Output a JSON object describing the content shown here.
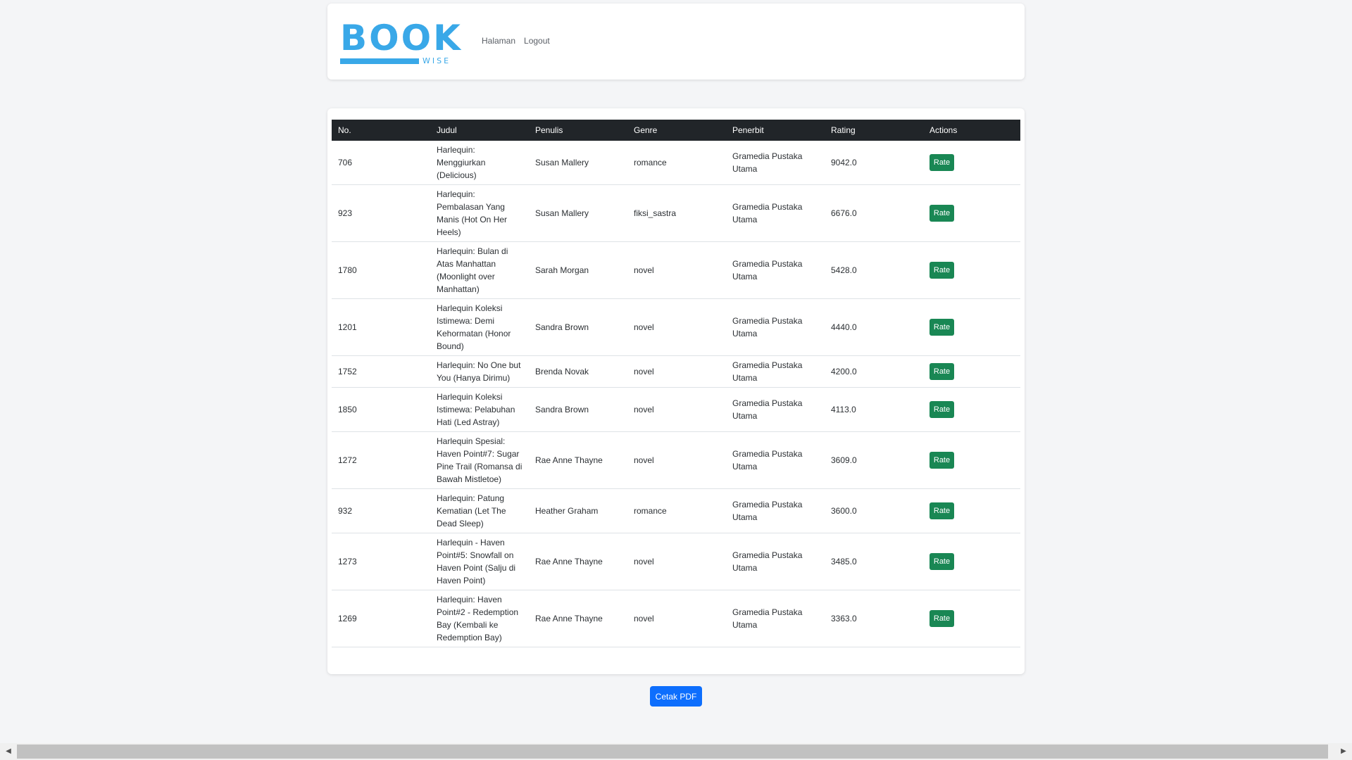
{
  "header": {
    "logo_word": "BOOK",
    "logo_sub": "WISE",
    "brand_color": "#39a8e8",
    "nav": [
      {
        "label": "Halaman"
      },
      {
        "label": "Logout"
      }
    ]
  },
  "table": {
    "columns": [
      "No.",
      "Judul",
      "Penulis",
      "Genre",
      "Penerbit",
      "Rating",
      "Actions"
    ],
    "action_label": "Rate",
    "rows": [
      {
        "no": "706",
        "judul": "Harlequin: Menggiurkan (Delicious)",
        "penulis": "Susan Mallery",
        "genre": "romance",
        "penerbit": "Gramedia Pustaka Utama",
        "rating": "9042.0"
      },
      {
        "no": "923",
        "judul": "Harlequin: Pembalasan Yang Manis (Hot On Her Heels)",
        "penulis": "Susan Mallery",
        "genre": "fiksi_sastra",
        "penerbit": "Gramedia Pustaka Utama",
        "rating": "6676.0"
      },
      {
        "no": "1780",
        "judul": "Harlequin: Bulan di Atas Manhattan (Moonlight over Manhattan)",
        "penulis": "Sarah Morgan",
        "genre": "novel",
        "penerbit": "Gramedia Pustaka Utama",
        "rating": "5428.0"
      },
      {
        "no": "1201",
        "judul": "Harlequin Koleksi Istimewa: Demi Kehormatan (Honor Bound)",
        "penulis": "Sandra Brown",
        "genre": "novel",
        "penerbit": "Gramedia Pustaka Utama",
        "rating": "4440.0"
      },
      {
        "no": "1752",
        "judul": "Harlequin: No One but You (Hanya Dirimu)",
        "penulis": "Brenda Novak",
        "genre": "novel",
        "penerbit": "Gramedia Pustaka Utama",
        "rating": "4200.0"
      },
      {
        "no": "1850",
        "judul": "Harlequin Koleksi Istimewa: Pelabuhan Hati (Led Astray)",
        "penulis": "Sandra Brown",
        "genre": "novel",
        "penerbit": "Gramedia Pustaka Utama",
        "rating": "4113.0"
      },
      {
        "no": "1272",
        "judul": "Harlequin Spesial: Haven Point#7: Sugar Pine Trail (Romansa di Bawah Mistletoe)",
        "penulis": "Rae Anne Thayne",
        "genre": "novel",
        "penerbit": "Gramedia Pustaka Utama",
        "rating": "3609.0"
      },
      {
        "no": "932",
        "judul": "Harlequin: Patung Kematian (Let The Dead Sleep)",
        "penulis": "Heather Graham",
        "genre": "romance",
        "penerbit": "Gramedia Pustaka Utama",
        "rating": "3600.0"
      },
      {
        "no": "1273",
        "judul": "Harlequin - Haven Point#5: Snowfall on Haven Point (Salju di Haven Point)",
        "penulis": "Rae Anne Thayne",
        "genre": "novel",
        "penerbit": "Gramedia Pustaka Utama",
        "rating": "3485.0"
      },
      {
        "no": "1269",
        "judul": "Harlequin: Haven Point#2 - Redemption Bay (Kembali ke Redemption Bay)",
        "penulis": "Rae Anne Thayne",
        "genre": "novel",
        "penerbit": "Gramedia Pustaka Utama",
        "rating": "3363.0"
      }
    ]
  },
  "footer": {
    "pdf_button_label": "Cetak PDF"
  },
  "colors": {
    "header_bg": "#212529",
    "rate_button": "#198754",
    "pdf_button": "#0d6efd"
  },
  "scrollbar": {
    "left_arrow_icon": "◀",
    "right_arrow_icon": "▶"
  }
}
